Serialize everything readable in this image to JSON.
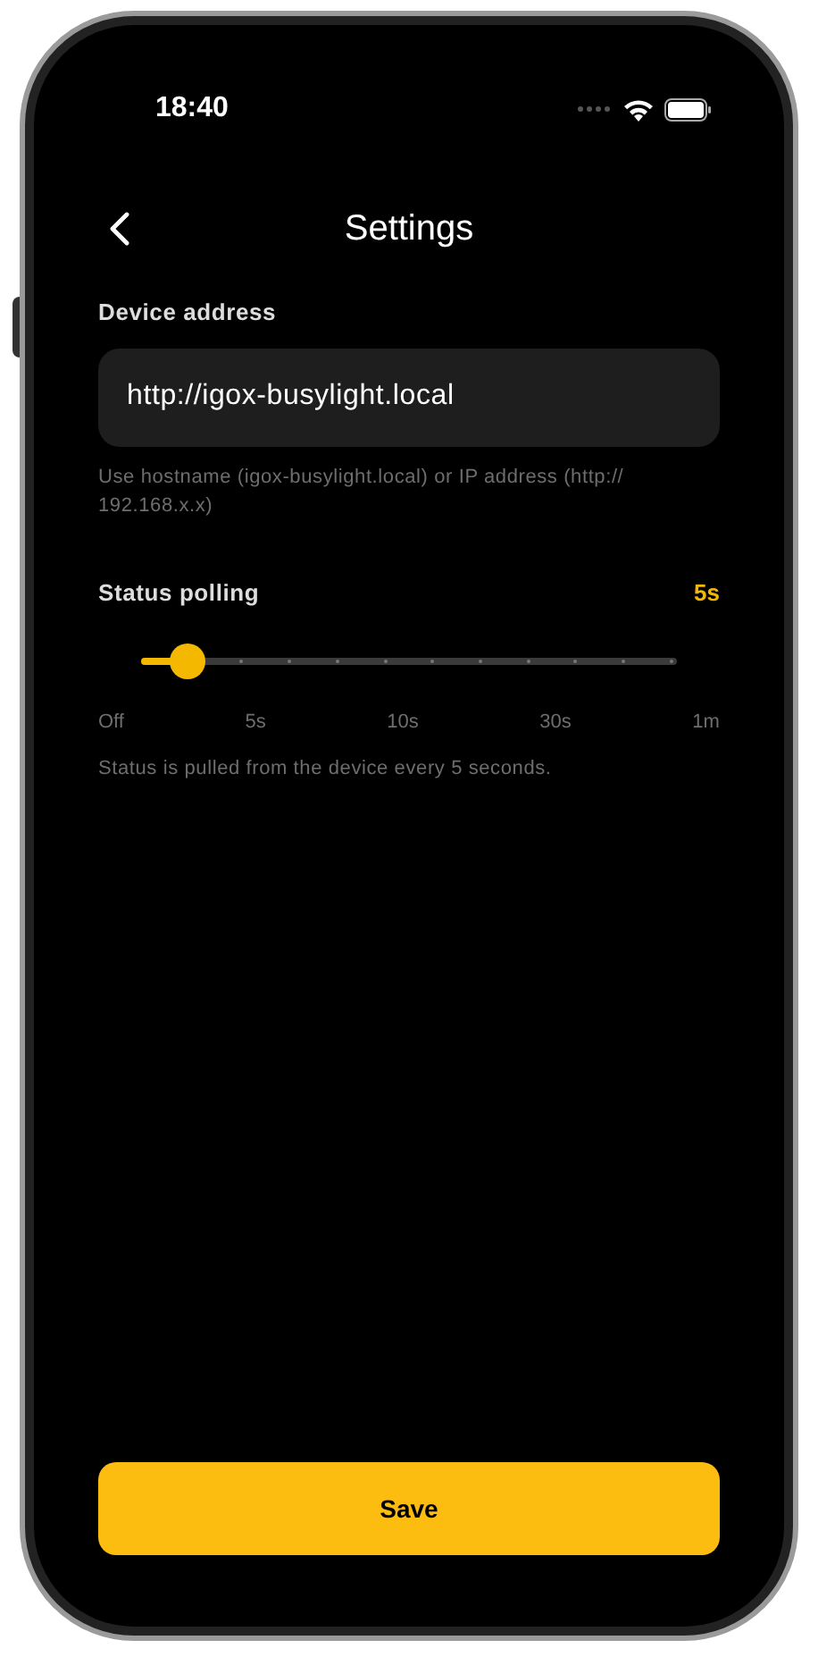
{
  "status_bar": {
    "time": "18:40"
  },
  "nav": {
    "title": "Settings"
  },
  "device_address": {
    "label": "Device address",
    "value": "http://igox-busylight.local",
    "hint": "Use hostname (igox-busylight.local) or IP address (http:// 192.168.x.x)"
  },
  "status_polling": {
    "label": "Status polling",
    "reading": "5s",
    "level": 0.085,
    "tick_labels": [
      "Off",
      "5s",
      "10s",
      "30s",
      "1m"
    ],
    "description": "Status is pulled from the device every 5 seconds."
  },
  "save_button": {
    "label": "Save"
  }
}
